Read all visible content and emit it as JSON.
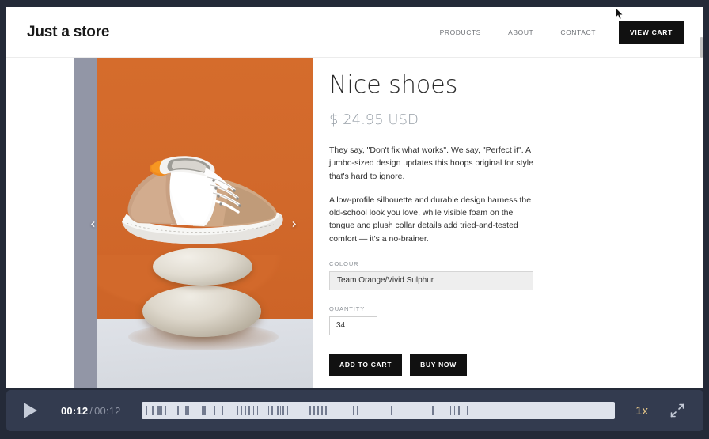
{
  "site": {
    "brand": "Just a store",
    "nav": [
      {
        "label": "PRODUCTS",
        "name": "nav-link-products"
      },
      {
        "label": "ABOUT",
        "name": "nav-link-about"
      },
      {
        "label": "CONTACT",
        "name": "nav-link-contact"
      }
    ],
    "view_cart_label": "VIEW CART"
  },
  "gallery": {
    "prev_icon": "‹",
    "next_icon": "›",
    "alt": "Nice shoes product photo on orange backdrop with stacked stones"
  },
  "product": {
    "title": "Nice shoes",
    "price": "$ 24.95 USD",
    "description_1": "They say, \"Don't fix what works\". We say, \"Perfect it\". A jumbo-sized design updates this hoops original for style that's hard to ignore.",
    "description_2": "A low-profile silhouette and durable design harness the old-school look you love, while visible foam on the tongue and plush collar details add tried-and-tested comfort — it's a no-brainer.",
    "colour_label": "COLOUR",
    "colour_value": "Team Orange/Vivid Sulphur",
    "quantity_label": "QUANTITY",
    "quantity_value": "34",
    "add_to_cart_label": "ADD TO CART",
    "buy_now_label": "BUY NOW"
  },
  "player": {
    "play_icon": "play-icon",
    "current_time": "00:12",
    "separator": "/",
    "total_time": "00:12",
    "speed_label": "1x",
    "fullscreen_icon": "expand-icon",
    "timeline_ticks": [
      5.7,
      13.3,
      20.3,
      22.2,
      24.4,
      29.0,
      44.8,
      54.4,
      56.0,
      57.6,
      65.6,
      74.8,
      76.4,
      78.0,
      90.0,
      99.6,
      118.0,
      123.0,
      128.0,
      133.0,
      138.0,
      143.0,
      157.0,
      161.0,
      164.5,
      168.0,
      171.5,
      175.0,
      180.5,
      208.0,
      213.0,
      218.0,
      223.0,
      228.0,
      262.0,
      267.0,
      286.0,
      291.0,
      309.0,
      360.0,
      382.0,
      387.0,
      392.0,
      403.0
    ]
  },
  "colors": {
    "chrome": "#242a38",
    "player_bar": "#333b4f",
    "timeline": "#dfe3ec",
    "accent_speed": "#e8c98a",
    "button_dark": "#111111",
    "backdrop_orange": "#d2692b"
  }
}
